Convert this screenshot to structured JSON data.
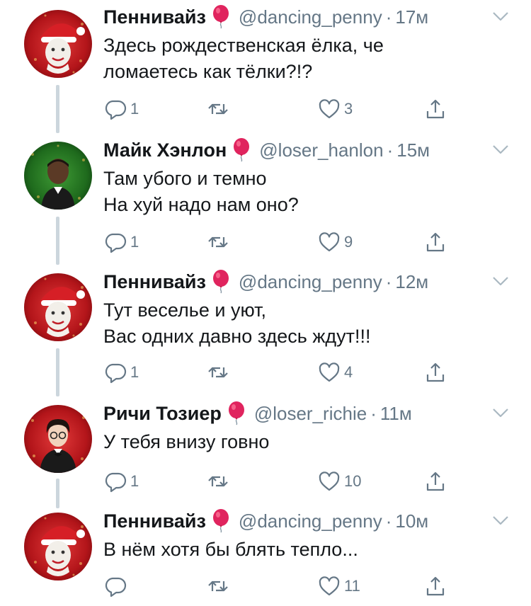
{
  "colors": {
    "text": "#14171a",
    "secondary": "#657786",
    "thread_line": "#ccd6dd",
    "balloon": "#e0245e"
  },
  "tweets": [
    {
      "name": "Пеннивайз",
      "handle": "@dancing_penny",
      "separator": "·",
      "time": "17м",
      "lines": [
        "Здесь рождественская ёлка, че",
        "ломаетесь как тёлки?!?"
      ],
      "replies": "1",
      "retweets": "",
      "likes": "3",
      "avatar": "pennywise-santa-avatar"
    },
    {
      "name": "Майк Хэнлон",
      "handle": "@loser_hanlon",
      "separator": "·",
      "time": "15м",
      "lines": [
        "Там убого и темно",
        "На хуй надо нам оно?"
      ],
      "replies": "1",
      "retweets": "",
      "likes": "9",
      "avatar": "mike-hanlon-avatar"
    },
    {
      "name": "Пеннивайз",
      "handle": "@dancing_penny",
      "separator": "·",
      "time": "12м",
      "lines": [
        "Тут веселье и уют,",
        "Вас одних давно здесь ждут!!!"
      ],
      "replies": "1",
      "retweets": "",
      "likes": "4",
      "avatar": "pennywise-santa-avatar"
    },
    {
      "name": "Ричи Тозиер",
      "handle": "@loser_richie",
      "separator": "·",
      "time": "11м",
      "lines": [
        "У тебя внизу говно"
      ],
      "replies": "1",
      "retweets": "",
      "likes": "10",
      "avatar": "richie-tozier-avatar"
    },
    {
      "name": "Пеннивайз",
      "handle": "@dancing_penny",
      "separator": "·",
      "time": "10м",
      "lines": [
        "В нём хотя бы блять тепло..."
      ],
      "replies": "",
      "retweets": "",
      "likes": "11",
      "avatar": "pennywise-santa-avatar"
    }
  ]
}
